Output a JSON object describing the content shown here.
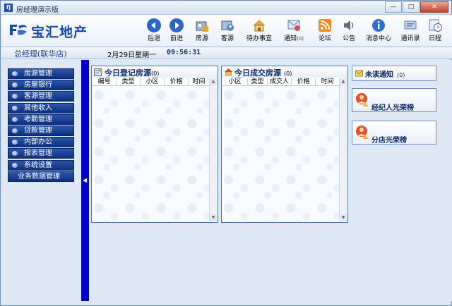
{
  "window": {
    "title": "房经理演示版",
    "app_icon": "app-logo-icon",
    "controls": [
      "minimize-icon",
      "maximize-icon",
      "close-icon"
    ]
  },
  "brand": {
    "name": "宝汇地产",
    "logo": "company-logo-icon"
  },
  "toolbar": {
    "back": {
      "label": "后退",
      "icon": "back-arrow-icon"
    },
    "forward": {
      "label": "前进",
      "icon": "forward-arrow-icon"
    },
    "listings": {
      "label": "房源",
      "icon": "house-listings-icon"
    },
    "clients": {
      "label": "客源",
      "icon": "clients-icon"
    },
    "todo": {
      "label": "待办事宜",
      "icon": "todo-home-icon"
    },
    "notice": {
      "label": "通知",
      "count": "(0)",
      "icon": "notice-icon"
    },
    "forum": {
      "label": "论坛",
      "icon": "rss-forum-icon"
    },
    "announce": {
      "label": "公告",
      "icon": "speaker-icon"
    },
    "messages": {
      "label": "消息中心",
      "icon": "info-icon"
    },
    "contacts": {
      "label": "通讯录",
      "icon": "contacts-icon"
    },
    "calendar": {
      "label": "日程",
      "icon": "calendar-clock-icon"
    }
  },
  "status": {
    "user": "总经理(联华店)",
    "date": "2月29日星期一",
    "time": "09:56:31"
  },
  "menu": [
    {
      "label": "房源管理"
    },
    {
      "label": "房屋银行"
    },
    {
      "label": "客源管理"
    },
    {
      "label": "其他收入"
    },
    {
      "label": "考勤管理"
    },
    {
      "label": "贷款管理"
    },
    {
      "label": "内部办公"
    },
    {
      "label": "报表管理"
    },
    {
      "label": "系统设置"
    },
    {
      "label": "业务数据管理"
    }
  ],
  "today_registered": {
    "title": "今日登记房源",
    "count": "(0)",
    "columns": [
      "编号",
      "类型",
      "小区",
      "价格",
      "时间"
    ]
  },
  "today_deals": {
    "title": "今日成交房源",
    "count": "(0)",
    "columns": [
      "小区",
      "类型",
      "成交人",
      "价格",
      "时间"
    ]
  },
  "unread": {
    "title": "未读通知",
    "count": "(0)"
  },
  "agent_honor": {
    "title": "经纪人光荣榜"
  },
  "branch_honor": {
    "title": "分店光荣榜"
  },
  "colors": {
    "menu_bg": "#0d2f7e",
    "divider": "#0000d8",
    "brand": "#1747a6"
  }
}
